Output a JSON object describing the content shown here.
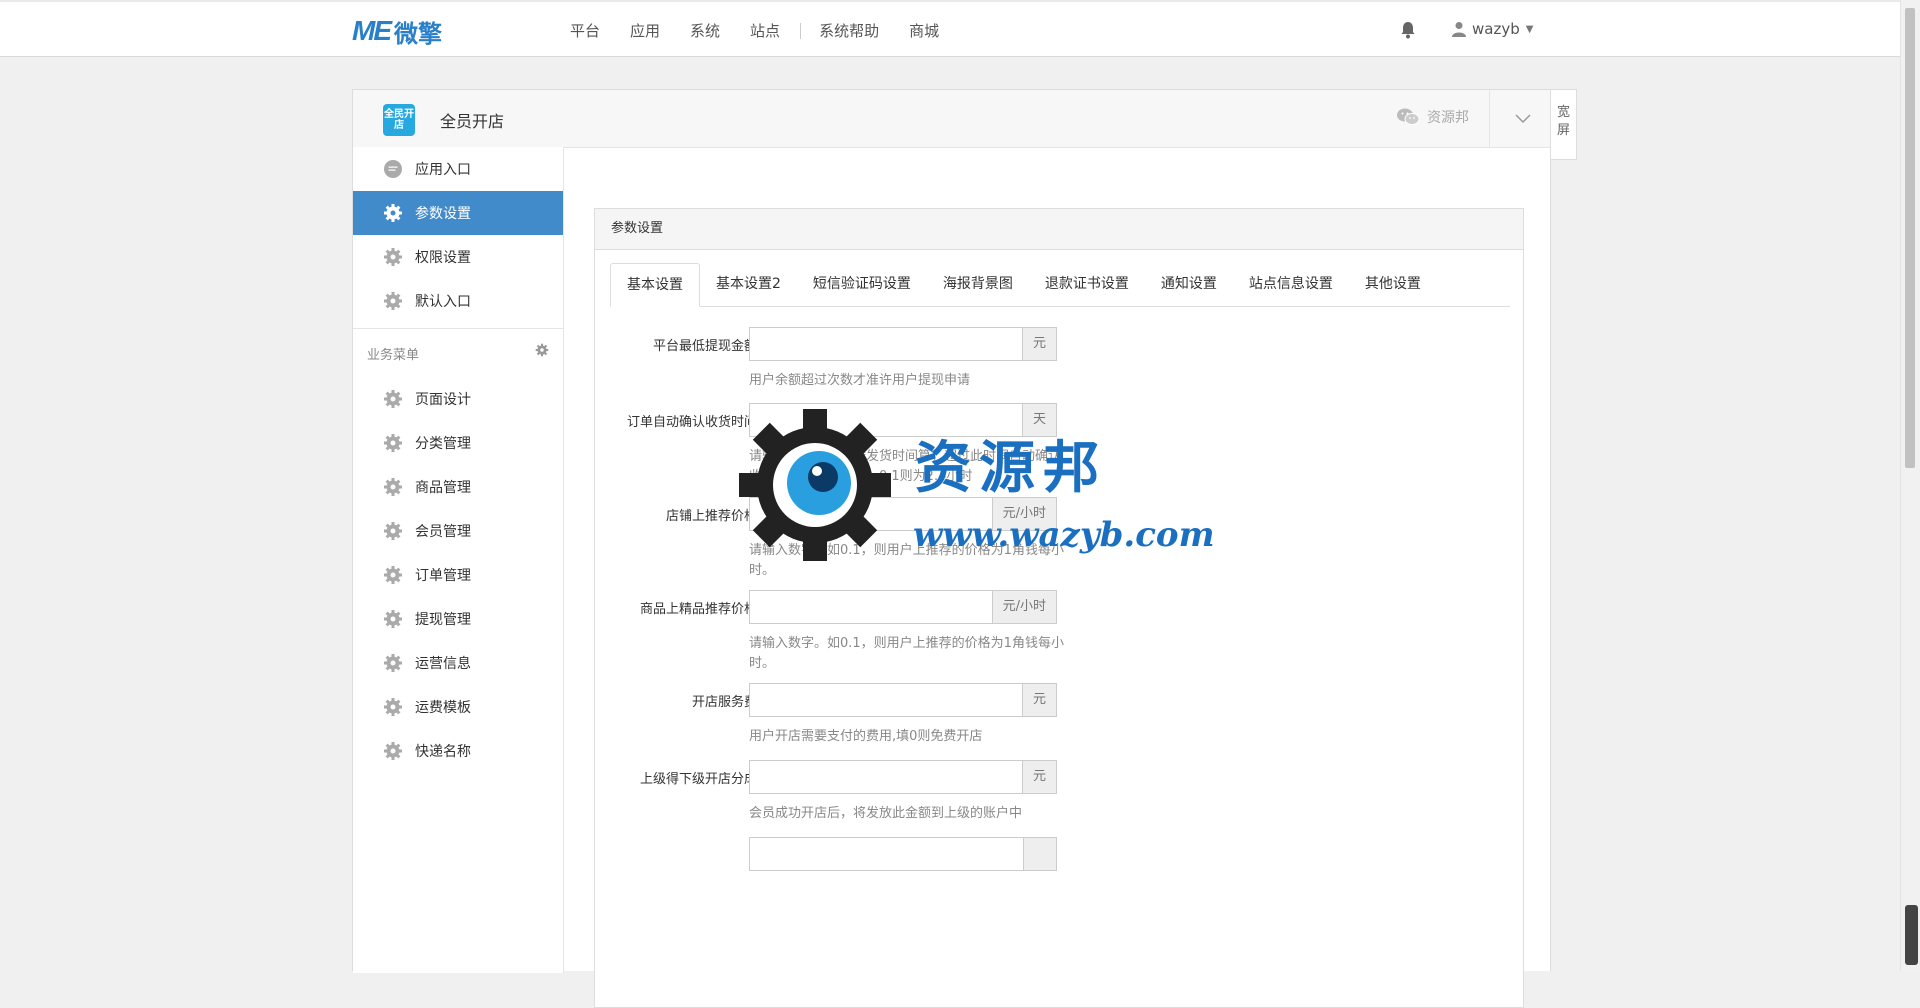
{
  "topbar": {
    "logo_mark": "ME",
    "logo_text": "微擎",
    "nav": [
      {
        "label": "平台"
      },
      {
        "label": "应用"
      },
      {
        "label": "系统"
      },
      {
        "label": "站点"
      },
      {
        "label": "系统帮助"
      },
      {
        "label": "商城"
      }
    ],
    "username": "wazyb"
  },
  "app": {
    "icon_text": "全民开店",
    "name": "全员开店",
    "account": "资源邦",
    "wide_label": "宽屏"
  },
  "sidebar": {
    "items": [
      {
        "label": "应用入口",
        "icon": "chat-icon"
      },
      {
        "label": "参数设置",
        "icon": "gear-icon",
        "active": true
      },
      {
        "label": "权限设置",
        "icon": "gear-icon"
      },
      {
        "label": "默认入口",
        "icon": "gear-icon"
      }
    ],
    "group_title": "业务菜单",
    "group_items": [
      {
        "label": "页面设计"
      },
      {
        "label": "分类管理"
      },
      {
        "label": "商品管理"
      },
      {
        "label": "会员管理"
      },
      {
        "label": "订单管理"
      },
      {
        "label": "提现管理"
      },
      {
        "label": "运营信息"
      },
      {
        "label": "运费模板"
      },
      {
        "label": "快递名称"
      }
    ]
  },
  "panel": {
    "title": "参数设置",
    "tabs": [
      {
        "label": "基本设置",
        "active": true
      },
      {
        "label": "基本设置2"
      },
      {
        "label": "短信验证码设置"
      },
      {
        "label": "海报背景图"
      },
      {
        "label": "退款证书设置"
      },
      {
        "label": "通知设置"
      },
      {
        "label": "站点信息设置"
      },
      {
        "label": "其他设置"
      }
    ],
    "fields": [
      {
        "label": "平台最低提现金额",
        "addon": "元",
        "value": "",
        "help": "用户余额超过次数才准许用户提现申请"
      },
      {
        "label": "订单自动确认收货时间",
        "addon": "天",
        "value": "",
        "help": "请输入数字，单位按发货时间算，超过此时间自动确认收货，可为小数，如：0.1则为2.4小时"
      },
      {
        "label": "店铺上推荐价格",
        "addon": "元/小时",
        "value": "",
        "help": "请输入数字。如0.1，则用户上推荐的价格为1角钱每小时。"
      },
      {
        "label": "商品上精品推荐价格",
        "addon": "元/小时",
        "value": "",
        "help": "请输入数字。如0.1，则用户上推荐的价格为1角钱每小时。"
      },
      {
        "label": "开店服务费",
        "addon": "元",
        "value": "",
        "help": "用户开店需要支付的费用,填0则免费开店"
      },
      {
        "label": "上级得下级开店分成",
        "addon": "元",
        "value": "",
        "help": "会员成功开店后，将发放此金额到上级的账户中"
      },
      {
        "label": "",
        "addon": "",
        "value": "",
        "help": ""
      }
    ]
  },
  "watermark": {
    "title": "资源邦",
    "url": "www.wazyb.com"
  },
  "colors": {
    "accent": "#428bca",
    "brand": "#2a7fc9",
    "app_icon": "#27a8e1"
  }
}
